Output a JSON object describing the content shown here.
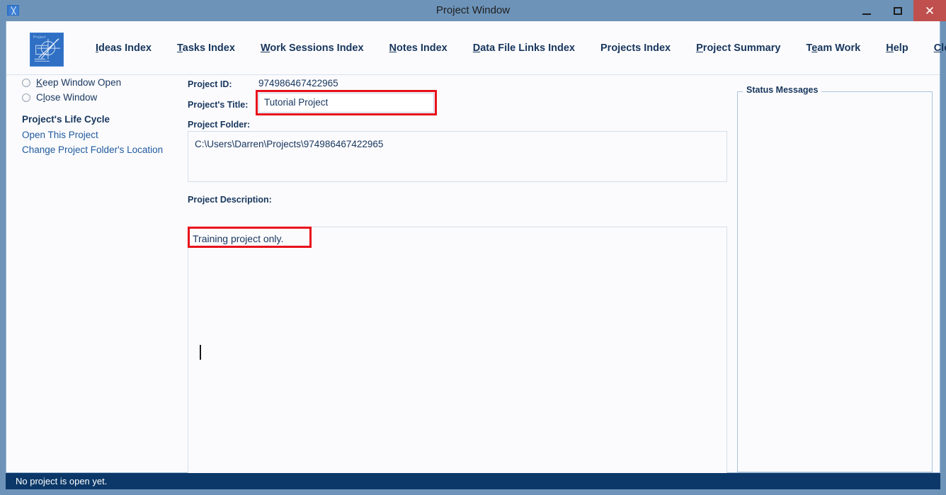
{
  "window": {
    "title": "Project Window",
    "icon": "project-app-icon",
    "controls": {
      "minimize": "–",
      "maximize": "□",
      "close": "✕"
    },
    "colors": {
      "titlebar": "#6d93b8",
      "close_button": "#c0504d",
      "client_background": "#fbfbfd",
      "accent_text": "#17365d",
      "link": "#1f5a9e",
      "statusbar": "#0b3868",
      "highlight": "#e8101a"
    }
  },
  "menubar": {
    "app_icon_label": "Project",
    "items": [
      {
        "label": "Ideas Index",
        "accel": "I"
      },
      {
        "label": "Tasks Index",
        "accel": "T"
      },
      {
        "label": "Work Sessions Index",
        "accel": "W"
      },
      {
        "label": "Notes Index",
        "accel": "N"
      },
      {
        "label": "Data File Links Index",
        "accel": "D"
      },
      {
        "label": "Projects Index",
        "accel": ""
      },
      {
        "label": "Project Summary",
        "accel": "P"
      },
      {
        "label": "Team Work",
        "accel": "e"
      },
      {
        "label": "Help",
        "accel": "H"
      },
      {
        "label": "Close Program",
        "accel": "C"
      }
    ]
  },
  "sidebar": {
    "radios": [
      {
        "label": "Keep Window Open",
        "accel": "K",
        "selected": false
      },
      {
        "label": "Close Window",
        "accel": "l",
        "selected": false
      }
    ],
    "section_heading": "Project's Life Cycle",
    "links": [
      "Open This Project",
      "Change Project Folder's Location"
    ]
  },
  "form": {
    "project_id_label": "Project ID:",
    "project_id_value": "974986467422965",
    "title_label": "Project's Title:",
    "title_value": "Tutorial Project",
    "folder_label": "Project Folder:",
    "folder_value": "C:\\Users\\Darren\\Projects\\974986467422965",
    "description_label": "Project Description:",
    "description_value": "Training project only."
  },
  "status_panel": {
    "legend": "Status Messages",
    "messages": ""
  },
  "statusbar": {
    "message": "No project is open yet."
  }
}
